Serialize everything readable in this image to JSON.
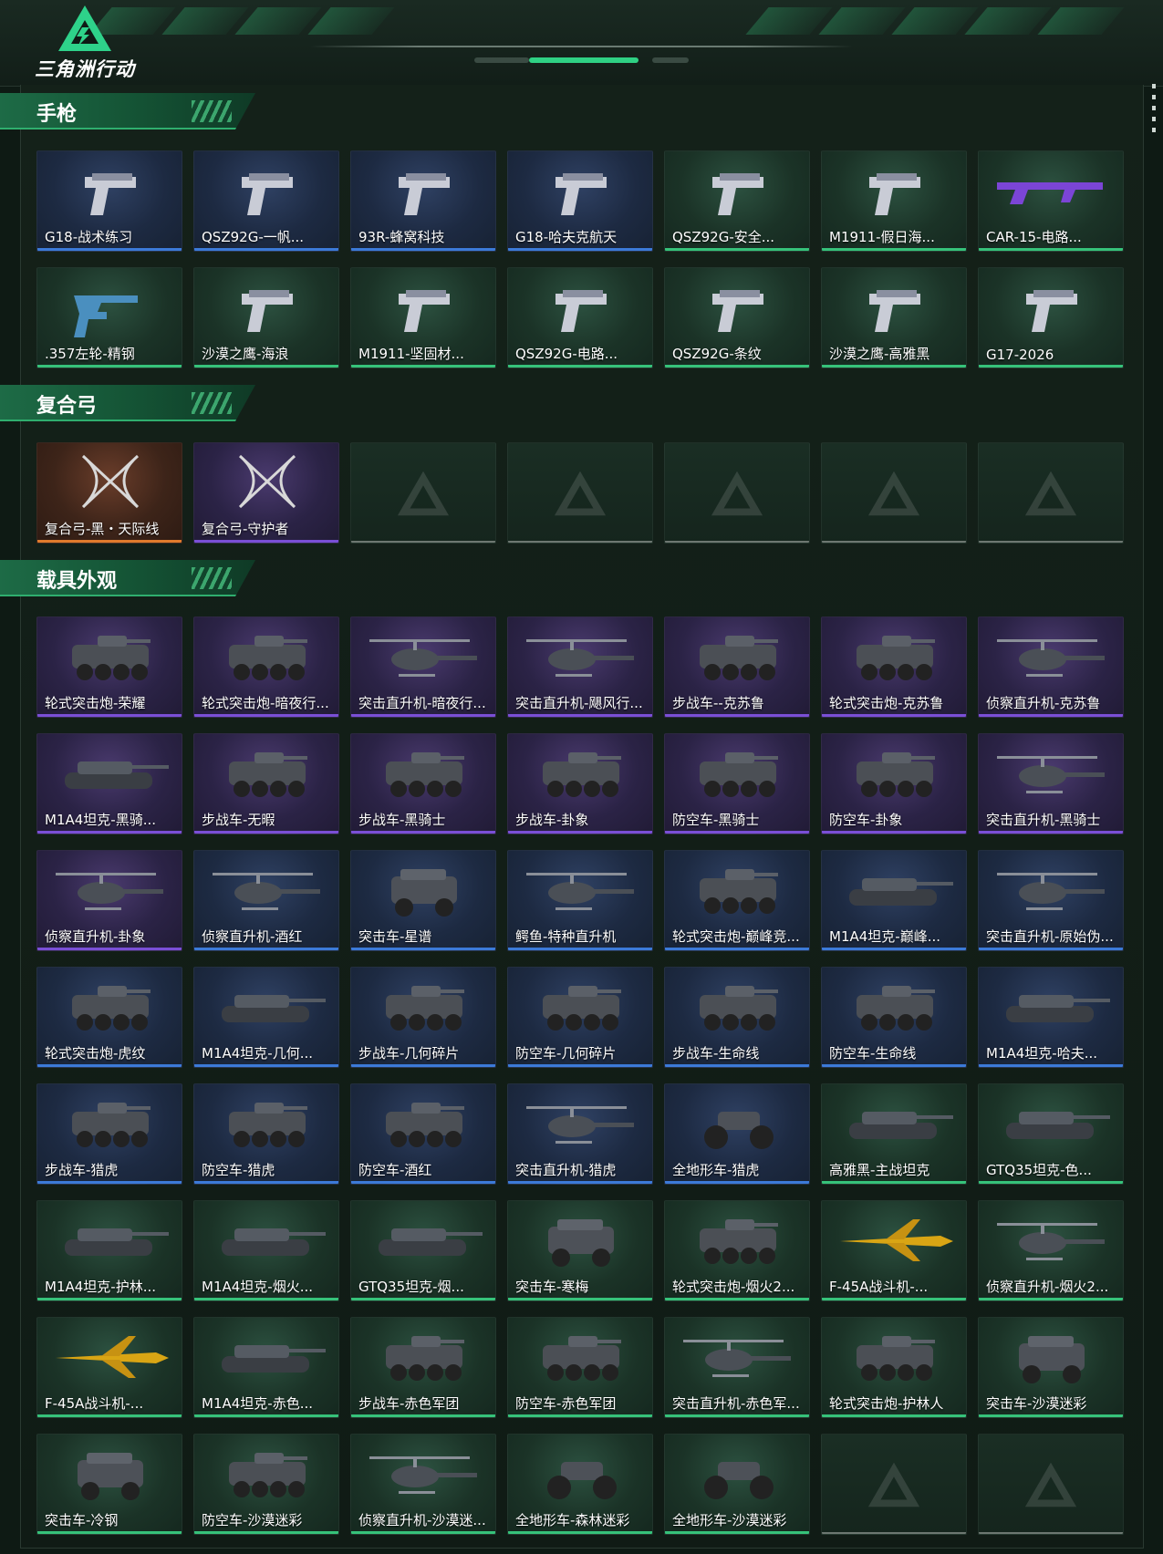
{
  "header": {
    "logo_text": "三角洲行动"
  },
  "sections": [
    {
      "title": "手枪",
      "items": [
        {
          "label": "G18-战术练习",
          "rarity": "blue",
          "icon": "pistol-icon"
        },
        {
          "label": "QSZ92G-一帆...",
          "rarity": "blue",
          "icon": "pistol-icon"
        },
        {
          "label": "93R-蜂窝科技",
          "rarity": "blue",
          "icon": "pistol-icon"
        },
        {
          "label": "G18-哈夫克航天",
          "rarity": "blue",
          "icon": "pistol-icon"
        },
        {
          "label": "QSZ92G-安全...",
          "rarity": "green",
          "icon": "pistol-icon"
        },
        {
          "label": "M1911-假日海...",
          "rarity": "green",
          "icon": "pistol-icon"
        },
        {
          "label": "CAR-15-电路...",
          "rarity": "green",
          "icon": "rifle-icon"
        },
        {
          "label": ".357左轮-精钢",
          "rarity": "green",
          "icon": "revolver-icon"
        },
        {
          "label": "沙漠之鹰-海浪",
          "rarity": "green",
          "icon": "pistol-icon"
        },
        {
          "label": "M1911-坚固材...",
          "rarity": "green",
          "icon": "pistol-icon"
        },
        {
          "label": "QSZ92G-电路...",
          "rarity": "green",
          "icon": "pistol-icon"
        },
        {
          "label": "QSZ92G-条纹",
          "rarity": "green",
          "icon": "pistol-icon"
        },
        {
          "label": "沙漠之鹰-高雅黑",
          "rarity": "green",
          "icon": "pistol-icon"
        },
        {
          "label": "G17-2026",
          "rarity": "green",
          "icon": "pistol-icon"
        }
      ]
    },
    {
      "title": "复合弓",
      "items": [
        {
          "label": "复合弓-黑・天际线",
          "rarity": "orange",
          "icon": "bow-icon"
        },
        {
          "label": "复合弓-守护者",
          "rarity": "purple",
          "icon": "bow-icon"
        },
        {
          "label": "",
          "rarity": "empty",
          "icon": "placeholder-logo-icon"
        },
        {
          "label": "",
          "rarity": "empty",
          "icon": "placeholder-logo-icon"
        },
        {
          "label": "",
          "rarity": "empty",
          "icon": "placeholder-logo-icon"
        },
        {
          "label": "",
          "rarity": "empty",
          "icon": "placeholder-logo-icon"
        },
        {
          "label": "",
          "rarity": "empty",
          "icon": "placeholder-logo-icon"
        }
      ]
    },
    {
      "title": "载具外观",
      "items": [
        {
          "label": "轮式突击炮-荣耀",
          "rarity": "purple",
          "icon": "armored-vehicle-icon"
        },
        {
          "label": "轮式突击炮-暗夜行...",
          "rarity": "purple",
          "icon": "armored-vehicle-icon"
        },
        {
          "label": "突击直升机-暗夜行...",
          "rarity": "purple",
          "icon": "helicopter-icon"
        },
        {
          "label": "突击直升机-飓风行...",
          "rarity": "purple",
          "icon": "helicopter-icon"
        },
        {
          "label": "步战车--克苏鲁",
          "rarity": "purple",
          "icon": "armored-vehicle-icon"
        },
        {
          "label": "轮式突击炮-克苏鲁",
          "rarity": "purple",
          "icon": "armored-vehicle-icon"
        },
        {
          "label": "侦察直升机-克苏鲁",
          "rarity": "purple",
          "icon": "helicopter-icon"
        },
        {
          "label": "M1A4坦克-黑骑...",
          "rarity": "purple",
          "icon": "tank-icon"
        },
        {
          "label": "步战车-无暇",
          "rarity": "purple",
          "icon": "armored-vehicle-icon"
        },
        {
          "label": "步战车-黑骑士",
          "rarity": "purple",
          "icon": "armored-vehicle-icon"
        },
        {
          "label": "步战车-卦象",
          "rarity": "purple",
          "icon": "armored-vehicle-icon"
        },
        {
          "label": "防空车-黑骑士",
          "rarity": "purple",
          "icon": "armored-vehicle-icon"
        },
        {
          "label": "防空车-卦象",
          "rarity": "purple",
          "icon": "armored-vehicle-icon"
        },
        {
          "label": "突击直升机-黑骑士",
          "rarity": "purple",
          "icon": "helicopter-icon"
        },
        {
          "label": "侦察直升机-卦象",
          "rarity": "purple",
          "icon": "helicopter-icon"
        },
        {
          "label": "侦察直升机-酒红",
          "rarity": "blue",
          "icon": "helicopter-icon"
        },
        {
          "label": "突击车-星谱",
          "rarity": "blue",
          "icon": "jeep-icon"
        },
        {
          "label": "鳄鱼-特种直升机",
          "rarity": "blue",
          "icon": "helicopter-icon"
        },
        {
          "label": "轮式突击炮-巅峰竞...",
          "rarity": "blue",
          "icon": "armored-vehicle-icon"
        },
        {
          "label": "M1A4坦克-巅峰...",
          "rarity": "blue",
          "icon": "tank-icon"
        },
        {
          "label": "突击直升机-原始伪...",
          "rarity": "blue",
          "icon": "helicopter-icon"
        },
        {
          "label": "轮式突击炮-虎纹",
          "rarity": "blue",
          "icon": "armored-vehicle-icon"
        },
        {
          "label": "M1A4坦克-几何...",
          "rarity": "blue",
          "icon": "tank-icon"
        },
        {
          "label": "步战车-几何碎片",
          "rarity": "blue",
          "icon": "armored-vehicle-icon"
        },
        {
          "label": "防空车-几何碎片",
          "rarity": "blue",
          "icon": "armored-vehicle-icon"
        },
        {
          "label": "步战车-生命线",
          "rarity": "blue",
          "icon": "armored-vehicle-icon"
        },
        {
          "label": "防空车-生命线",
          "rarity": "blue",
          "icon": "armored-vehicle-icon"
        },
        {
          "label": "M1A4坦克-哈夫...",
          "rarity": "blue",
          "icon": "tank-icon"
        },
        {
          "label": "步战车-猎虎",
          "rarity": "blue",
          "icon": "armored-vehicle-icon"
        },
        {
          "label": "防空车-猎虎",
          "rarity": "blue",
          "icon": "armored-vehicle-icon"
        },
        {
          "label": "防空车-酒红",
          "rarity": "blue",
          "icon": "armored-vehicle-icon"
        },
        {
          "label": "突击直升机-猎虎",
          "rarity": "blue",
          "icon": "helicopter-icon"
        },
        {
          "label": "全地形车-猎虎",
          "rarity": "blue",
          "icon": "atv-icon"
        },
        {
          "label": "高雅黑-主战坦克",
          "rarity": "green",
          "icon": "tank-icon"
        },
        {
          "label": "GTQ35坦克-色...",
          "rarity": "green",
          "icon": "tank-icon"
        },
        {
          "label": "M1A4坦克-护林...",
          "rarity": "green",
          "icon": "tank-icon"
        },
        {
          "label": "M1A4坦克-烟火...",
          "rarity": "green",
          "icon": "tank-icon"
        },
        {
          "label": "GTQ35坦克-烟...",
          "rarity": "green",
          "icon": "tank-icon"
        },
        {
          "label": "突击车-寒梅",
          "rarity": "green",
          "icon": "jeep-icon"
        },
        {
          "label": "轮式突击炮-烟火2...",
          "rarity": "green",
          "icon": "armored-vehicle-icon"
        },
        {
          "label": "F-45A战斗机-...",
          "rarity": "green",
          "icon": "jet-icon"
        },
        {
          "label": "侦察直升机-烟火2...",
          "rarity": "green",
          "icon": "helicopter-icon"
        },
        {
          "label": "F-45A战斗机-...",
          "rarity": "green",
          "icon": "jet-icon"
        },
        {
          "label": "M1A4坦克-赤色...",
          "rarity": "green",
          "icon": "tank-icon"
        },
        {
          "label": "步战车-赤色军团",
          "rarity": "green",
          "icon": "armored-vehicle-icon"
        },
        {
          "label": "防空车-赤色军团",
          "rarity": "green",
          "icon": "armored-vehicle-icon"
        },
        {
          "label": "突击直升机-赤色军...",
          "rarity": "green",
          "icon": "helicopter-icon"
        },
        {
          "label": "轮式突击炮-护林人",
          "rarity": "green",
          "icon": "armored-vehicle-icon"
        },
        {
          "label": "突击车-沙漠迷彩",
          "rarity": "green",
          "icon": "jeep-icon"
        },
        {
          "label": "突击车-冷钢",
          "rarity": "green",
          "icon": "jeep-icon"
        },
        {
          "label": "防空车-沙漠迷彩",
          "rarity": "green",
          "icon": "armored-vehicle-icon"
        },
        {
          "label": "侦察直升机-沙漠迷...",
          "rarity": "green",
          "icon": "helicopter-icon"
        },
        {
          "label": "全地形车-森林迷彩",
          "rarity": "green",
          "icon": "atv-icon"
        },
        {
          "label": "全地形车-沙漠迷彩",
          "rarity": "green",
          "icon": "atv-icon"
        },
        {
          "label": "",
          "rarity": "empty",
          "icon": "placeholder-logo-icon"
        },
        {
          "label": "",
          "rarity": "empty",
          "icon": "placeholder-logo-icon"
        }
      ]
    }
  ],
  "colors": {
    "purple": "#7a4fd6",
    "blue": "#3c7ad8",
    "green": "#36c27a",
    "orange": "#e07a2c",
    "accent": "#2fae6e"
  }
}
